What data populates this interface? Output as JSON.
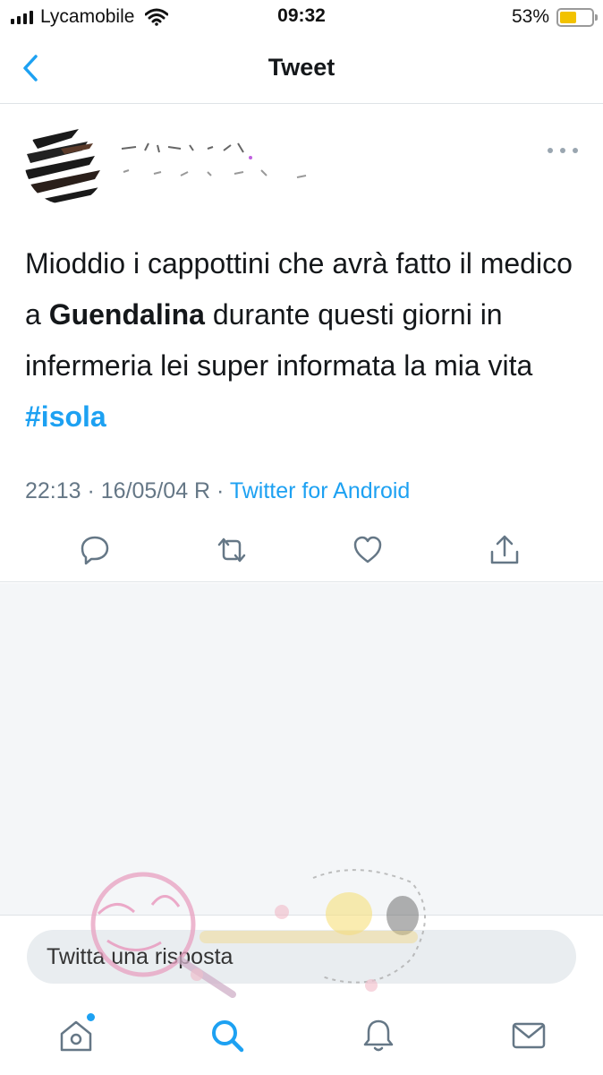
{
  "status_bar": {
    "carrier": "Lycamobile",
    "time": "09:32",
    "battery_percent": "53%",
    "battery_level": 0.53,
    "battery_color": "#f2c200"
  },
  "nav": {
    "title": "Tweet",
    "back_icon": "chevron-left-icon"
  },
  "tweet": {
    "text_before": "Mioddio i cappottini che avrà fatto il medico a ",
    "mention": "Guendalina",
    "text_after": " durante questi giorni in infermeria lei super informata la mia vita ",
    "hashtag": "#isola",
    "timestamp": "22:13 · 16/05/04 R · ",
    "source": "Twitter for Android",
    "actions": [
      "reply-icon",
      "retweet-icon",
      "like-icon",
      "share-icon"
    ]
  },
  "reply": {
    "placeholder": "Twitta una risposta"
  },
  "tabs": [
    "home-icon",
    "search-icon",
    "notifications-icon",
    "messages-icon"
  ],
  "colors": {
    "accent": "#1da1f2",
    "text": "#14171a",
    "muted": "#657786",
    "background_empty": "#f4f6f8"
  }
}
